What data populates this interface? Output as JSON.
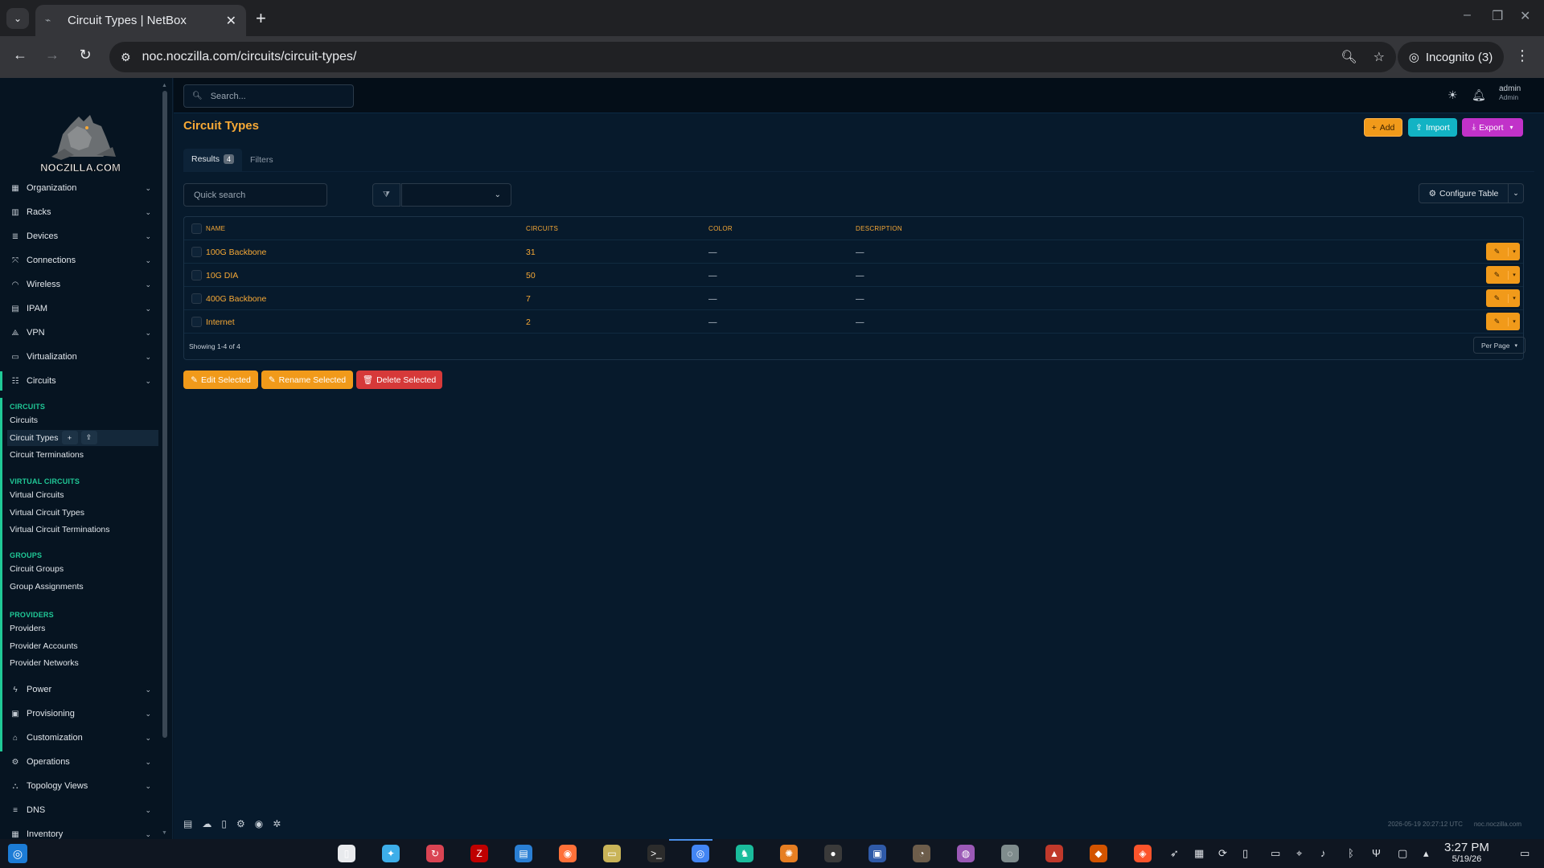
{
  "browser": {
    "tab_title": "Circuit Types | NetBox",
    "url": "noc.noczilla.com/circuits/circuit-types/",
    "incognito_label": "Incognito (3)"
  },
  "brand": {
    "logo_text": "NOCZILLA.COM"
  },
  "sidebar": {
    "menu_top": [
      {
        "label": "Organization",
        "icon": "building-icon"
      },
      {
        "label": "Racks",
        "icon": "rack-icon"
      },
      {
        "label": "Devices",
        "icon": "server-icon"
      },
      {
        "label": "Connections",
        "icon": "connection-icon"
      },
      {
        "label": "Wireless",
        "icon": "wifi-icon"
      },
      {
        "label": "IPAM",
        "icon": "ipam-icon"
      },
      {
        "label": "VPN",
        "icon": "vpn-icon"
      },
      {
        "label": "Virtualization",
        "icon": "monitor-icon"
      },
      {
        "label": "Circuits",
        "icon": "circuit-icon"
      }
    ],
    "sections": [
      {
        "heading": "CIRCUITS",
        "links": [
          "Circuits",
          "Circuit Types",
          "Circuit Terminations"
        ]
      },
      {
        "heading": "VIRTUAL CIRCUITS",
        "links": [
          "Virtual Circuits",
          "Virtual Circuit Types",
          "Virtual Circuit Terminations"
        ]
      },
      {
        "heading": "GROUPS",
        "links": [
          "Circuit Groups",
          "Group Assignments"
        ]
      },
      {
        "heading": "PROVIDERS",
        "links": [
          "Providers",
          "Provider Accounts",
          "Provider Networks"
        ]
      }
    ],
    "menu_bottom": [
      {
        "label": "Power",
        "icon": "power-icon"
      },
      {
        "label": "Provisioning",
        "icon": "file-icon"
      },
      {
        "label": "Customization",
        "icon": "customization-icon"
      },
      {
        "label": "Operations",
        "icon": "operations-icon"
      },
      {
        "label": "Topology Views",
        "icon": "topology-icon"
      },
      {
        "label": "DNS",
        "icon": "dns-icon"
      },
      {
        "label": "Inventory",
        "icon": "inventory-icon"
      }
    ]
  },
  "topbar": {
    "search_placeholder": "Search...",
    "user_name": "admin",
    "user_role": "Admin"
  },
  "page": {
    "title": "Circuit Types",
    "buttons": {
      "add": "Add",
      "import": "Import",
      "export": "Export"
    },
    "tabs": {
      "results": "Results",
      "results_count": "4",
      "filters": "Filters"
    },
    "quick_search_placeholder": "Quick search",
    "configure_table": "Configure Table"
  },
  "table": {
    "columns": [
      "NAME",
      "CIRCUITS",
      "COLOR",
      "DESCRIPTION"
    ],
    "rows": [
      {
        "name": "100G Backbone",
        "circuits": "31",
        "color": "—",
        "description": "—"
      },
      {
        "name": "10G DIA",
        "circuits": "50",
        "color": "—",
        "description": "—"
      },
      {
        "name": "400G Backbone",
        "circuits": "7",
        "color": "—",
        "description": "—"
      },
      {
        "name": "Internet",
        "circuits": "2",
        "color": "—",
        "description": "—"
      }
    ],
    "showing": "Showing 1-4 of 4",
    "per_page": "Per Page"
  },
  "bulk_actions": {
    "edit": "Edit Selected",
    "rename": "Rename Selected",
    "delete": "Delete Selected"
  },
  "footer": {
    "timestamp": "2026-05-19 20:27:12 UTC",
    "host": "noc.noczilla.com"
  },
  "taskbar": {
    "time": "3:27 PM",
    "date": "5/19/26"
  },
  "colors": {
    "accent": "#f7a936",
    "teal": "#20c997",
    "import": "#12b3c4",
    "export": "#c132c9",
    "danger": "#d63939"
  }
}
